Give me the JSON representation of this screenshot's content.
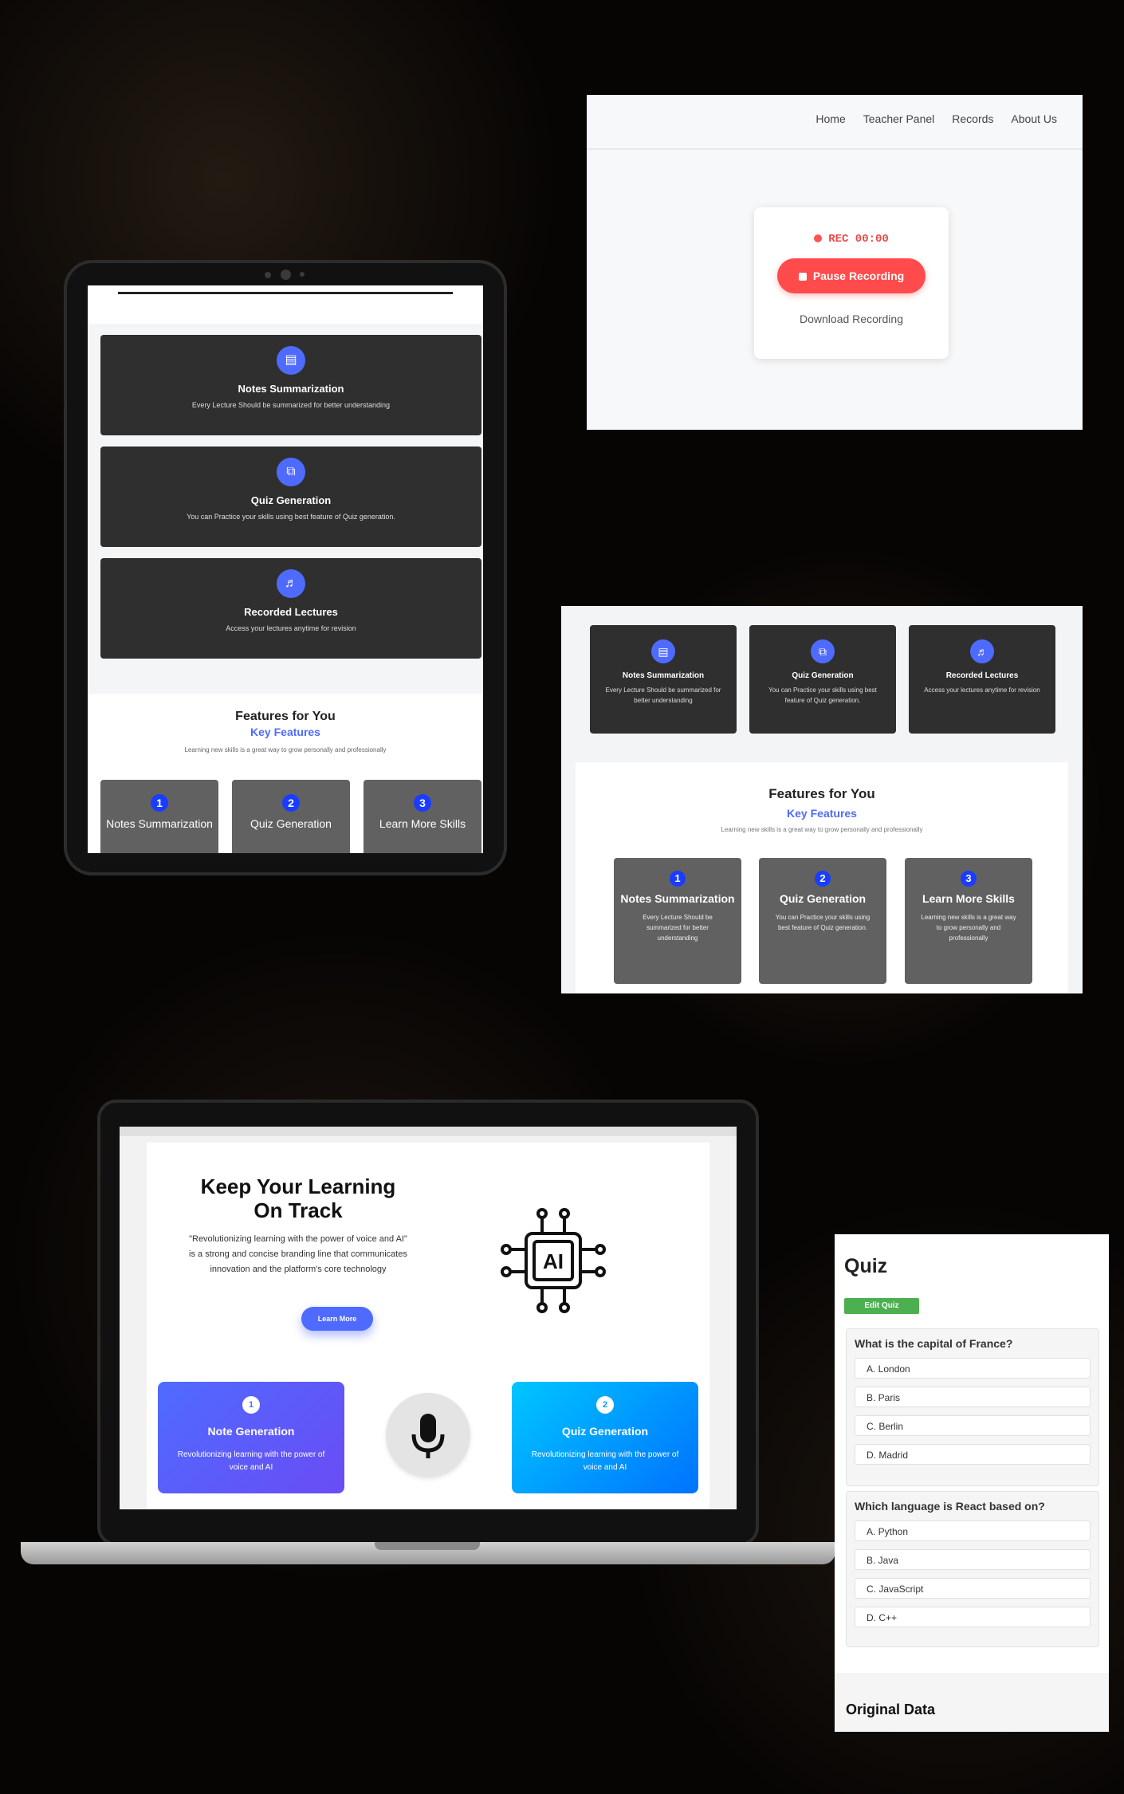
{
  "recording": {
    "nav": [
      "Home",
      "Teacher Panel",
      "Records",
      "About Us"
    ],
    "status": "REC 00:00",
    "pause_label": "Pause Recording",
    "download_label": "Download Recording",
    "accent": "#ff4b4b"
  },
  "tablet": {
    "cards": [
      {
        "title": "Notes Summarization",
        "desc": "Every Lecture Should be summarized for better understanding",
        "icon": "notes-icon"
      },
      {
        "title": "Quiz Generation",
        "desc": "You can Practice your skills using best feature of Quiz generation.",
        "icon": "quiz-icon"
      },
      {
        "title": "Recorded Lectures",
        "desc": "Access your lectures anytime for revision",
        "icon": "recorded-lecture-icon"
      }
    ],
    "features": {
      "heading": "Features for You",
      "subheading": "Key Features",
      "text": "Learning new skills is a great way to grow personally and professionally",
      "items": [
        {
          "num": "1",
          "title": "Notes Summarization"
        },
        {
          "num": "2",
          "title": "Quiz Generation"
        },
        {
          "num": "3",
          "title": "Learn More Skills"
        }
      ]
    }
  },
  "features_panel": {
    "cards": [
      {
        "title": "Notes Summarization",
        "desc": "Every Lecture Should be summarized for better understanding"
      },
      {
        "title": "Quiz Generation",
        "desc": "You can Practice your skills using best feature of Quiz generation."
      },
      {
        "title": "Recorded Lectures",
        "desc": "Access your lectures anytime for revision"
      }
    ],
    "heading": "Features for You",
    "subheading": "Key Features",
    "text": "Learning new skills is a great way to grow personally and professionally",
    "items": [
      {
        "num": "1",
        "title": "Notes Summarization",
        "desc": "Every Lecture Should be summarized for better understanding"
      },
      {
        "num": "2",
        "title": "Quiz Generation",
        "desc": "You can Practice your skills using best feature of Quiz generation."
      },
      {
        "num": "3",
        "title": "Learn More Skills",
        "desc": "Learning new skills is a great way to grow personally and professionally"
      }
    ],
    "accent": "#4f6bff"
  },
  "laptop": {
    "heading": "Keep Your Learning On Track",
    "paragraph": "\"Revolutionizing learning with the power of voice and AI\" is a strong and concise branding line that communicates innovation and the platform's core technology",
    "button": "Learn More",
    "ai_label": "AI",
    "cards": [
      {
        "num": "1",
        "title": "Note Generation",
        "desc": "Revolutionizing learning with the power of voice and AI"
      },
      {
        "num": "2",
        "title": "Quiz Generation",
        "desc": "Revolutionizing learning with the power of voice and AI"
      }
    ]
  },
  "quiz": {
    "title": "Quiz",
    "edit_label": "Edit Quiz",
    "questions": [
      {
        "q": "What is the capital of France?",
        "options": [
          "A. London",
          "B. Paris",
          "C. Berlin",
          "D. Madrid"
        ]
      },
      {
        "q": "Which language is React based on?",
        "options": [
          "A. Python",
          "B. Java",
          "C. JavaScript",
          "D. C++"
        ]
      }
    ],
    "footer": "Original Data",
    "edit_color": "#4caf50"
  }
}
